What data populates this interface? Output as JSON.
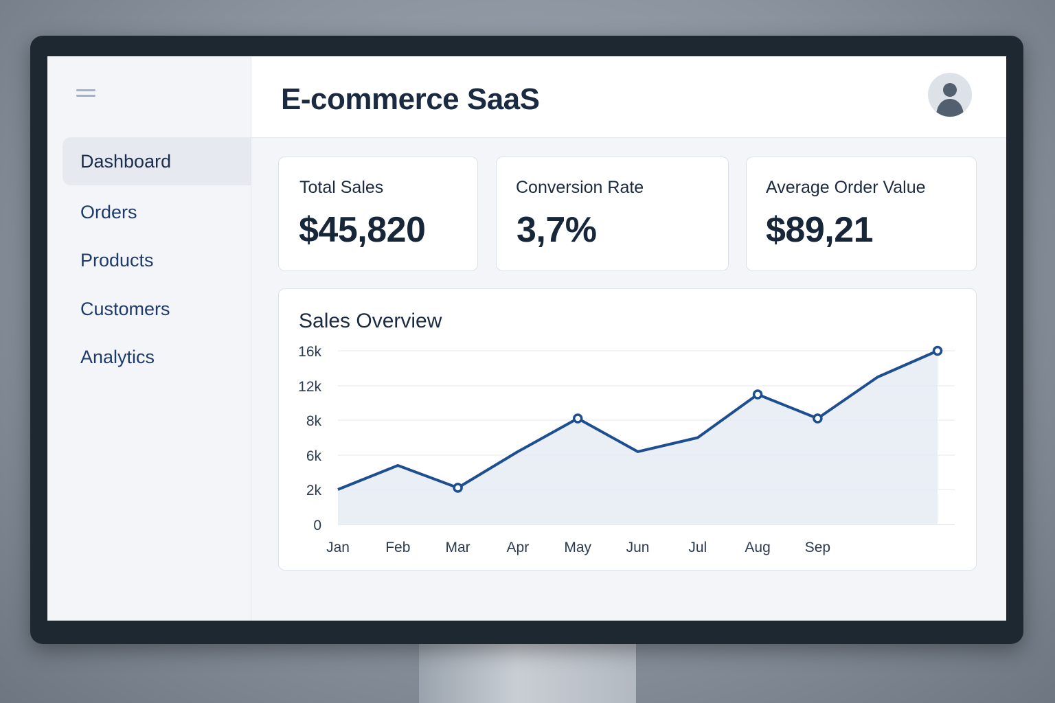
{
  "app": {
    "title": "E-commerce SaaS"
  },
  "sidebar": {
    "menu_icon": "hamburger-menu-icon",
    "items": [
      {
        "label": "Dashboard",
        "active": true
      },
      {
        "label": "Orders"
      },
      {
        "label": "Products"
      },
      {
        "label": "Customers"
      },
      {
        "label": "Analytics"
      }
    ]
  },
  "header": {
    "avatar_icon": "user-avatar-icon"
  },
  "kpis": [
    {
      "label": "Total Sales",
      "value": "$45,820"
    },
    {
      "label": "Conversion Rate",
      "value": "3,7%"
    },
    {
      "label": "Average Order Value",
      "value": "$89,21"
    }
  ],
  "colors": {
    "accent": "#1d4e8f",
    "area_fill": "#e6ebf3",
    "nav_text": "#1d3a6b",
    "active_nav_bg": "#e6eaf0"
  },
  "chart_data": {
    "type": "line",
    "title": "Sales Overview",
    "y_ticks": [
      "0",
      "2k",
      "6k",
      "8k",
      "12k",
      "16k"
    ],
    "x_ticks": [
      "Jan",
      "Feb",
      "Mar",
      "Apr",
      "May",
      "Jun",
      "Jul",
      "Aug",
      "Sep"
    ],
    "points": [
      {
        "x": "Jan",
        "y": 2000
      },
      {
        "x": "Feb",
        "y": 4800
      },
      {
        "x": "Mar",
        "y": 2200,
        "marker": true
      },
      {
        "x": "Apr",
        "y": 6200
      },
      {
        "x": "May",
        "y": 8200,
        "marker": true
      },
      {
        "x": "Jun",
        "y": 6200
      },
      {
        "x": "Jul",
        "y": 7000
      },
      {
        "x": "Aug",
        "y": 11000,
        "marker": true
      },
      {
        "x": "Sep",
        "y": 8200,
        "marker": true
      },
      {
        "x": "",
        "y": 13000
      },
      {
        "x": "",
        "y": 16000,
        "marker": true
      }
    ],
    "grid": true,
    "area_fill": true
  }
}
